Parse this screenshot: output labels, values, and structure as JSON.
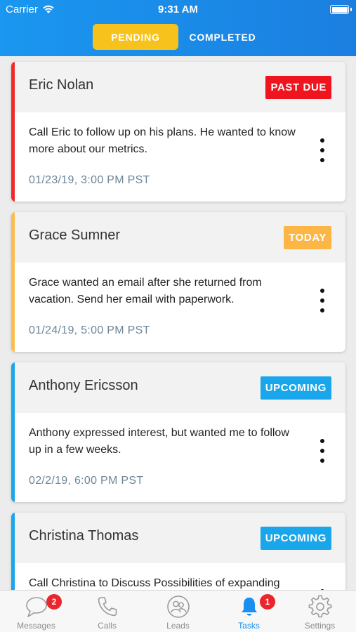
{
  "status_bar": {
    "carrier": "Carrier",
    "time": "9:31 AM",
    "wifi_icon": "wifi-icon",
    "battery_icon": "battery-icon"
  },
  "segmented_control": {
    "pending_label": "PENDING",
    "completed_label": "COMPLETED",
    "selected": "PENDING",
    "active_color": "#f7c21b"
  },
  "tasks": [
    {
      "name": "Eric Nolan",
      "status": "PAST DUE",
      "accent_color": "#f02a2a",
      "description": "Call Eric to follow up on his plans. He wanted to know more about our metrics.",
      "datetime": "01/23/19, 3:00 PM PST"
    },
    {
      "name": "Grace Sumner",
      "status": "TODAY",
      "accent_color": "#fbbd4e",
      "description": "Grace wanted an email after she returned from vacation. Send her email with paperwork.",
      "datetime": "01/24/19, 5:00 PM PST"
    },
    {
      "name": "Anthony Ericsson",
      "status": "UPCOMING",
      "accent_color": "#1aa6ea",
      "description": "Anthony expressed interest, but wanted me to follow up in a few weeks.",
      "datetime": "02/2/19, 6:00 PM PST"
    },
    {
      "name": "Christina Thomas",
      "status": "UPCOMING",
      "accent_color": "#1aa6ea",
      "description": "Call Christina to Discuss Possibilities of expanding",
      "datetime": ""
    }
  ],
  "tabbar": {
    "items": [
      {
        "label": "Messages",
        "icon": "chat-bubble-icon",
        "badge": "2"
      },
      {
        "label": "Calls",
        "icon": "phone-icon",
        "badge": ""
      },
      {
        "label": "Leads",
        "icon": "people-icon",
        "badge": ""
      },
      {
        "label": "Tasks",
        "icon": "bell-icon",
        "badge": "1"
      },
      {
        "label": "Settings",
        "icon": "gear-icon",
        "badge": ""
      }
    ],
    "active": "Tasks",
    "active_color": "#1a8ff0",
    "badge_color": "#e8262b"
  }
}
